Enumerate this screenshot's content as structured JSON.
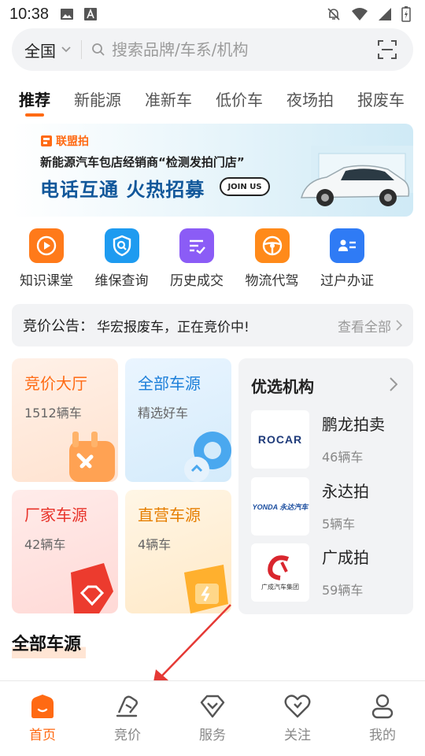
{
  "status_bar": {
    "time": "10:38"
  },
  "search": {
    "region": "全国",
    "placeholder": "搜索品牌/车系/机构"
  },
  "tabs": [
    "推荐",
    "新能源",
    "准新车",
    "低价车",
    "夜场拍",
    "报废车"
  ],
  "banner": {
    "brand": "联盟拍",
    "line1": "新能源汽车包店经销商“检测发拍门店”",
    "line2": "电话互通 火热招募",
    "join": "JOIN US"
  },
  "quick_links": [
    {
      "label": "知识课堂",
      "icon": "play-icon",
      "color": "#ff7a1a"
    },
    {
      "label": "维保查询",
      "icon": "search-shield-icon",
      "color": "#1e9bf0"
    },
    {
      "label": "历史成交",
      "icon": "checklist-icon",
      "color": "#8b5cf6"
    },
    {
      "label": "物流代驾",
      "icon": "steering-wheel-icon",
      "color": "#ff8a1a"
    },
    {
      "label": "过户办证",
      "icon": "id-card-icon",
      "color": "#2f7bf5"
    }
  ],
  "notice": {
    "title": "竞价公告：",
    "text": "华宏报废车，正在竞价中!",
    "more": "查看全部"
  },
  "cards": {
    "auction_hall": {
      "title": "竞价大厅",
      "sub": "1512辆车",
      "color": "#ff6a13"
    },
    "all_sources": {
      "title": "全部车源",
      "sub": "精选好车",
      "color": "#1c7fd9"
    },
    "factory": {
      "title": "厂家车源",
      "sub": "42辆车",
      "color": "#e8332a"
    },
    "direct": {
      "title": "直营车源",
      "sub": "4辆车",
      "color": "#e67e00"
    }
  },
  "orgs": {
    "title": "优选机构",
    "items": [
      {
        "name": "鹏龙拍卖",
        "count": "46辆车",
        "logo_text": "ROCAR"
      },
      {
        "name": "永达拍",
        "count": "5辆车",
        "logo_text": "YONDA 永达汽车"
      },
      {
        "name": "广成拍",
        "count": "59辆车",
        "logo_text": "广成汽车集团"
      }
    ]
  },
  "section": {
    "title": "全部车源"
  },
  "bottom_nav": [
    {
      "label": "首页",
      "icon": "home-icon",
      "active": true
    },
    {
      "label": "竞价",
      "icon": "gavel-icon",
      "active": false
    },
    {
      "label": "服务",
      "icon": "diamond-icon",
      "active": false
    },
    {
      "label": "关注",
      "icon": "heart-icon",
      "active": false
    },
    {
      "label": "我的",
      "icon": "person-icon",
      "active": false
    }
  ],
  "colors": {
    "accent": "#ff6a13",
    "inactive": "#888888"
  }
}
